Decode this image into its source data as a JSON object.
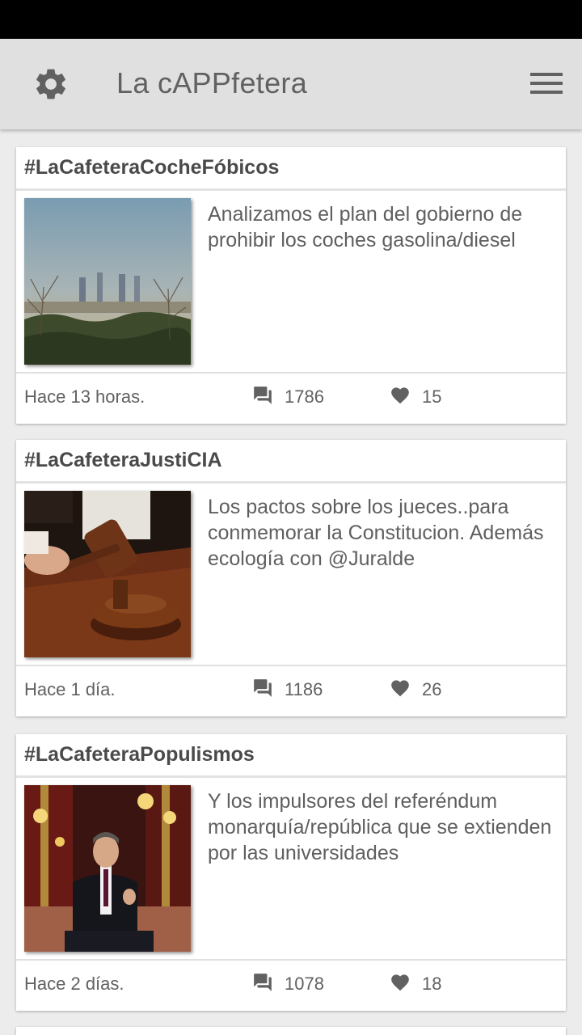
{
  "app": {
    "title": "La cAPPfetera"
  },
  "icons": {
    "settings": "gear-icon",
    "menu": "hamburger-menu-icon",
    "comments": "comments-icon",
    "likes": "heart-icon"
  },
  "colors": {
    "appbar": "#e0e0e0",
    "background": "#ececec",
    "text": "#5f5f5f",
    "icon": "#616161"
  },
  "posts": [
    {
      "tag": "#LaCafeteraCocheFóbicos",
      "text": "Analizamos el plan del gobierno de prohibir los coches gasolina/diesel",
      "time": "Hace 13 horas.",
      "comments": "1786",
      "likes": "15",
      "image": "madrid-skyline-smog"
    },
    {
      "tag": "#LaCafeteraJustiCIA",
      "text": "Los pactos sobre los jueces..para conmemorar la Constitucion. Además ecología con @Juralde",
      "time": "Hace 1 día.",
      "comments": "1186",
      "likes": "26",
      "image": "judge-gavel"
    },
    {
      "tag": "#LaCafeteraPopulismos",
      "text": "Y los impulsores del referéndum monarquía/república que se extienden por las universidades",
      "time": "Hace 2 días.",
      "comments": "1078",
      "likes": "18",
      "image": "king-speech"
    }
  ]
}
